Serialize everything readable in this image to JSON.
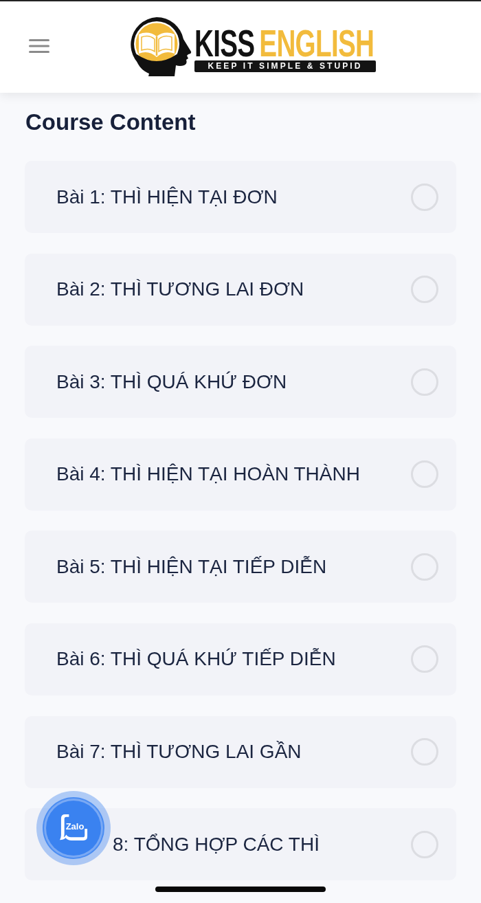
{
  "header": {
    "logo": {
      "word_1": "KISS",
      "word_2": "ENGLISH",
      "tagline": "KEEP IT SIMPLE & STUPID"
    }
  },
  "course": {
    "title": "Course Content",
    "lessons": [
      {
        "label": "Bài 1: THÌ HIỆN TẠI ĐƠN",
        "checked": false
      },
      {
        "label": "Bài 2: THÌ TƯƠNG LAI ĐƠN",
        "checked": false
      },
      {
        "label": "Bài 3: THÌ QUÁ KHỨ ĐƠN",
        "checked": false
      },
      {
        "label": "Bài 4: THÌ HIỆN TẠI HOÀN THÀNH",
        "checked": false
      },
      {
        "label": "Bài 5: THÌ HIỆN TẠI TIẾP DIỄN",
        "checked": false
      },
      {
        "label": "Bài 6: THÌ QUÁ KHỨ TIẾP DIỄN",
        "checked": false
      },
      {
        "label": "Bài 7: THÌ TƯƠNG LAI GẦN",
        "checked": false
      },
      {
        "label": "8: TỔNG HỢP CÁC THÌ",
        "checked": false
      }
    ]
  },
  "zalo_button": {
    "label": "Zalo"
  }
}
